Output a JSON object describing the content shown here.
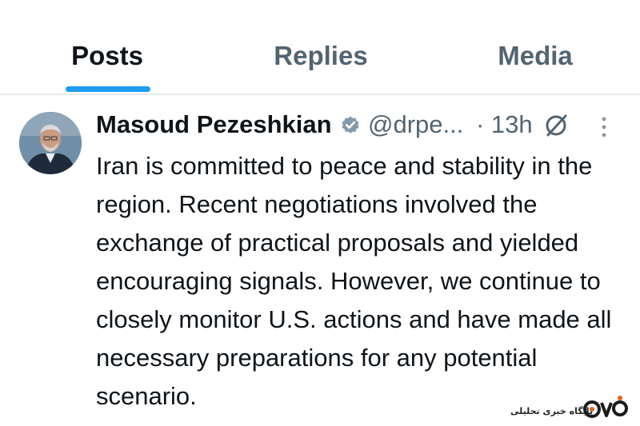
{
  "tabs": [
    {
      "label": "Posts",
      "active": true
    },
    {
      "label": "Replies",
      "active": false
    },
    {
      "label": "Media",
      "active": false
    }
  ],
  "post": {
    "author_name": "Masoud Pezeshkian",
    "verified": true,
    "handle": "@drpe...",
    "timestamp": "· 13h",
    "text": "Iran is committed to peace and stability in the region. Recent negotiations involved the exchange of practical proposals and yielded encouraging signals. However, we continue to closely monitor U.S. actions and have made all necessary preparations for any potential scenario."
  },
  "icons": {
    "verified": "verified-badge-icon",
    "grok": "grok-icon",
    "more": "more-options-icon"
  },
  "watermark": {
    "text": "پایگاه خبری تحلیلی",
    "logo": "site-logo"
  },
  "colors": {
    "accent": "#1d9bf0",
    "text_primary": "#0f1419",
    "text_secondary": "#536471",
    "verified_badge": "#829aab"
  }
}
